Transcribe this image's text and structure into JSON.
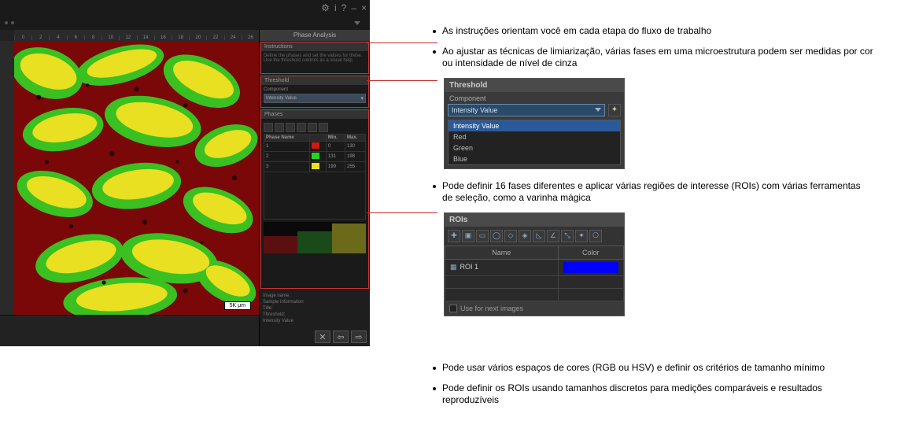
{
  "app": {
    "window_title": "Phase Analysis",
    "titlebar_icons": {
      "gear": "⚙",
      "info": "i",
      "help": "?",
      "minimize": "–",
      "close": "×"
    },
    "ruler_ticks": [
      "0",
      "2",
      "4",
      "6",
      "8",
      "10",
      "12",
      "14",
      "16",
      "18",
      "20",
      "22",
      "24",
      "26"
    ],
    "scale_bar": "5K μm",
    "side": {
      "title": "Phase Analysis",
      "instructions_header": "Instructions",
      "instructions_body": "Define the phases and set the values for these. Use the threshold controls as a visual help.",
      "threshold_header": "Threshold",
      "component_label": "Component",
      "component_value": "Intensity Value",
      "phases_header": "Phases",
      "table_headers": {
        "name": "Phase Name",
        "min": "Min.",
        "max": "Max."
      },
      "phases": [
        {
          "name": "1",
          "color": "#d01818",
          "min": "0",
          "max": "130"
        },
        {
          "name": "2",
          "color": "#2ad020",
          "min": "131",
          "max": "198"
        },
        {
          "name": "3",
          "color": "#e8e020",
          "min": "199",
          "max": "255"
        }
      ],
      "info_lines": [
        "Image name:",
        "Sample information",
        "Title:",
        "Threshold:",
        "Intensity Value"
      ]
    },
    "nav": {
      "close": "✕",
      "back": "⇦",
      "next": "⇨"
    }
  },
  "bullets": {
    "b1": "As instruções orientam você em cada etapa do fluxo de trabalho",
    "b2": "Ao ajustar as técnicas de limiarização, várias fases em uma microestrutura podem ser medidas por cor ou intensidade de nível de cinza",
    "b3": "Pode definir 16 fases diferentes e aplicar várias regiões de interesse (ROIs) com várias ferramentas de seleção, como a varinha mágica",
    "b4": "Pode usar vários espaços de cores (RGB ou HSV) e definir os critérios de tamanho mínimo",
    "b5": "Pode definir os ROIs usando tamanhos discretos para medições comparáveis e resultados reproduzíveis"
  },
  "threshold_panel": {
    "title": "Threshold",
    "component_label": "Component",
    "selected": "Intensity Value",
    "options": [
      "Intensity Value",
      "Red",
      "Green",
      "Blue"
    ]
  },
  "roi_panel": {
    "title": "ROIs",
    "columns": {
      "name": "Name",
      "color": "Color"
    },
    "rows": [
      {
        "name": "ROI 1",
        "color": "#0000ff"
      }
    ],
    "footer_label": "Use for next images"
  },
  "icon_names": {
    "roi_tools": [
      "new-roi",
      "window-roi",
      "rect-roi",
      "circle-roi",
      "poly-roi",
      "rot-rect-roi",
      "triangle-roi",
      "angle-roi",
      "flip-roi",
      "wand-roi",
      "crop-roi"
    ]
  }
}
